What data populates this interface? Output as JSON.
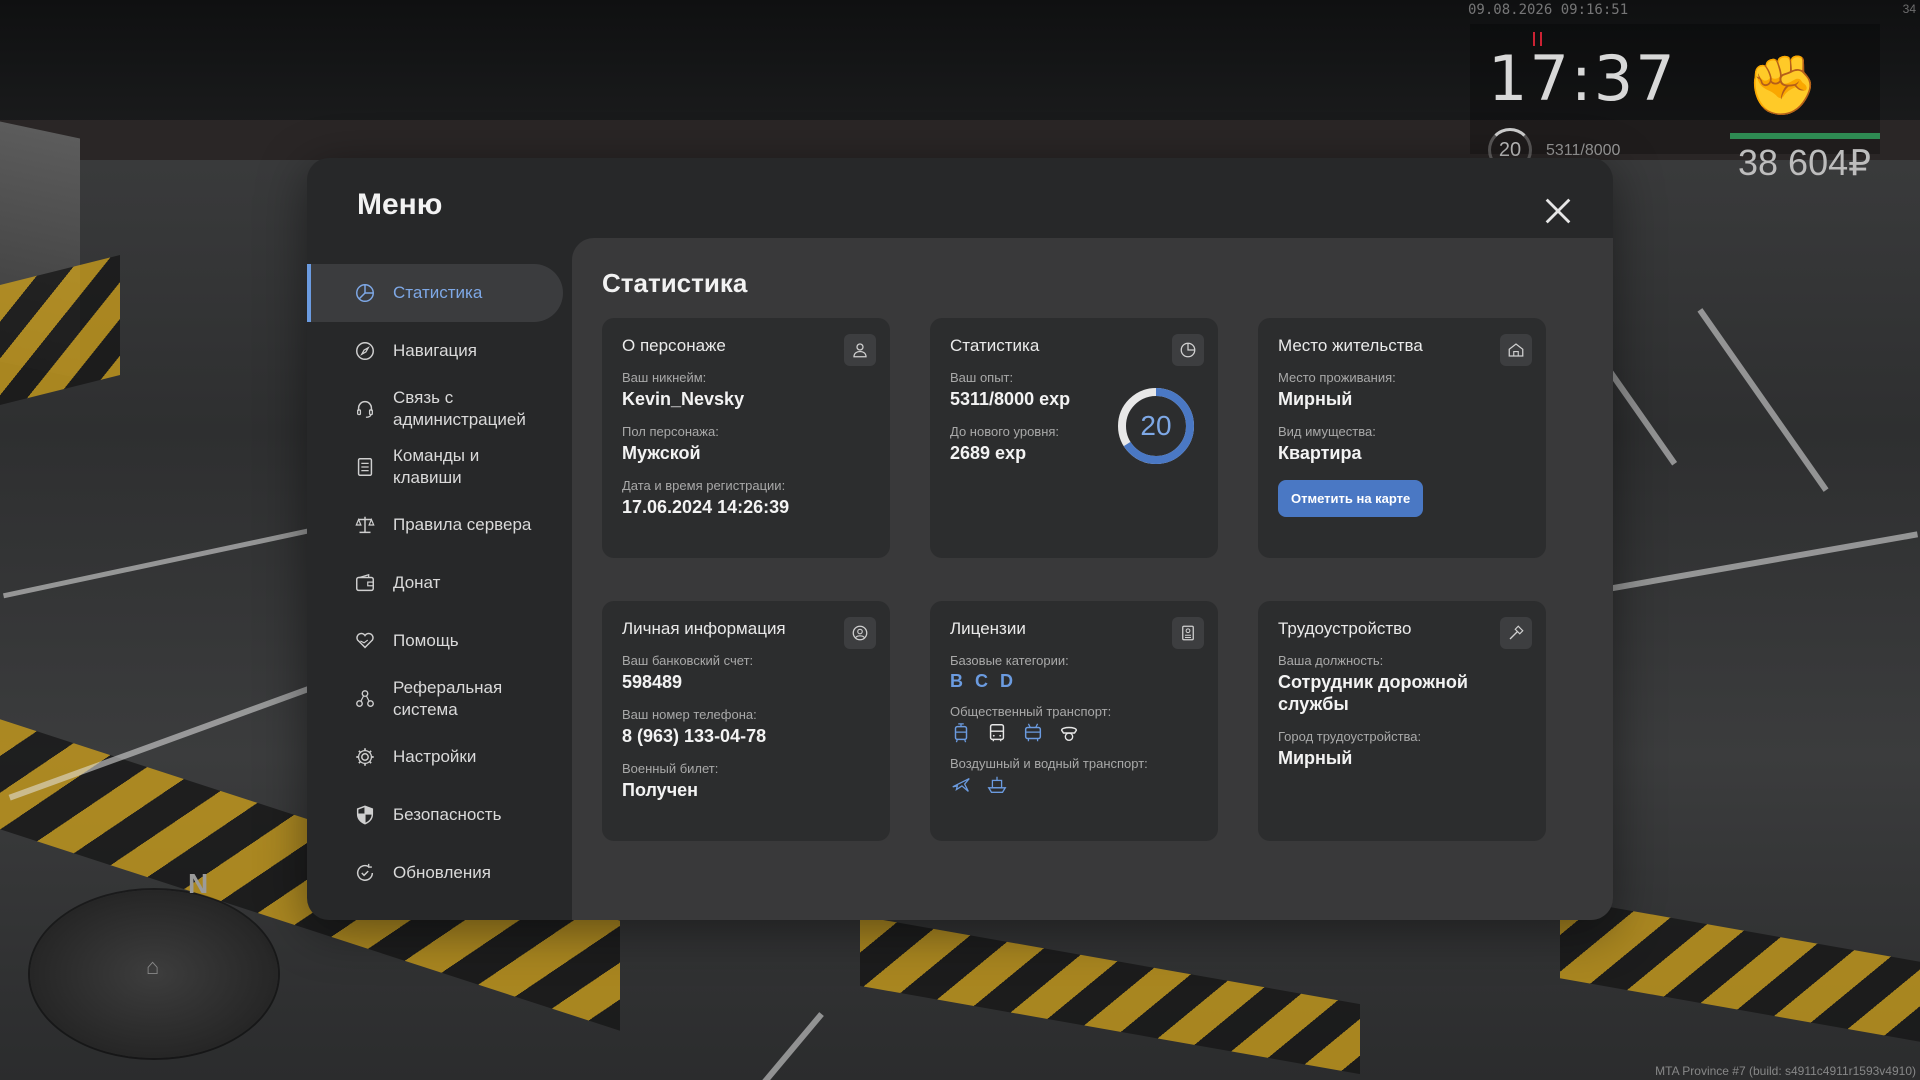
{
  "hud": {
    "datetime": "09.08.2026 09:16:51",
    "corner": "34",
    "time": "17:37",
    "level": "20",
    "exp": "5311/8000",
    "money": "38 604₽",
    "compass": "N",
    "build": "MTA Province #7 (build: s4911c4911r1593v4910)"
  },
  "menu": {
    "title": "Меню",
    "sidebar": [
      {
        "label": "Статистика",
        "icon": "pie-chart-icon",
        "active": true
      },
      {
        "label": "Навигация",
        "icon": "compass-icon"
      },
      {
        "label": "Связь с администрацией",
        "icon": "headset-icon"
      },
      {
        "label": "Команды и клавиши",
        "icon": "document-list-icon"
      },
      {
        "label": "Правила сервера",
        "icon": "scales-icon"
      },
      {
        "label": "Донат",
        "icon": "wallet-icon"
      },
      {
        "label": "Помощь",
        "icon": "heart-hand-icon"
      },
      {
        "label": "Реферальная система",
        "icon": "referral-icon"
      },
      {
        "label": "Настройки",
        "icon": "gear-icon"
      },
      {
        "label": "Безопасность",
        "icon": "shield-icon"
      },
      {
        "label": "Обновления",
        "icon": "refresh-check-icon"
      }
    ]
  },
  "stats": {
    "title": "Статистика",
    "character": {
      "title": "О персонаже",
      "nickname_label": "Ваш никнейм:",
      "nickname": "Kevin_Nevsky",
      "gender_label": "Пол персонажа:",
      "gender": "Мужской",
      "reg_label": "Дата и время регистрации:",
      "reg": "17.06.2024 14:26:39"
    },
    "experience": {
      "title": "Статистика",
      "exp_label": "Ваш опыт:",
      "exp": "5311/8000 exp",
      "next_label": "До нового уровня:",
      "next": "2689 exp",
      "level": "20",
      "progress": 0.66
    },
    "residence": {
      "title": "Место жительства",
      "place_label": "Место проживания:",
      "place": "Мирный",
      "property_label": "Вид имущества:",
      "property": "Квартира",
      "button": "Отметить на карте"
    },
    "personal": {
      "title": "Личная информация",
      "bank_label": "Ваш банковский счет:",
      "bank": "598489",
      "phone_label": "Ваш номер телефона:",
      "phone": "8 (963) 133-04-78",
      "military_label": "Военный билет:",
      "military": "Получен"
    },
    "licenses": {
      "title": "Лицензии",
      "base_label": "Базовые категории:",
      "categories": [
        "B",
        "C",
        "D"
      ],
      "public_label": "Общественный транспорт:",
      "air_label": "Воздушный и водный транспорт:"
    },
    "job": {
      "title": "Трудоустройство",
      "position_label": "Ваша должность:",
      "position": "Сотрудник дорожной службы",
      "city_label": "Город трудоустройства:",
      "city": "Мирный"
    }
  },
  "colors": {
    "accent": "#6b9be0",
    "hp": "#2e8a52"
  }
}
